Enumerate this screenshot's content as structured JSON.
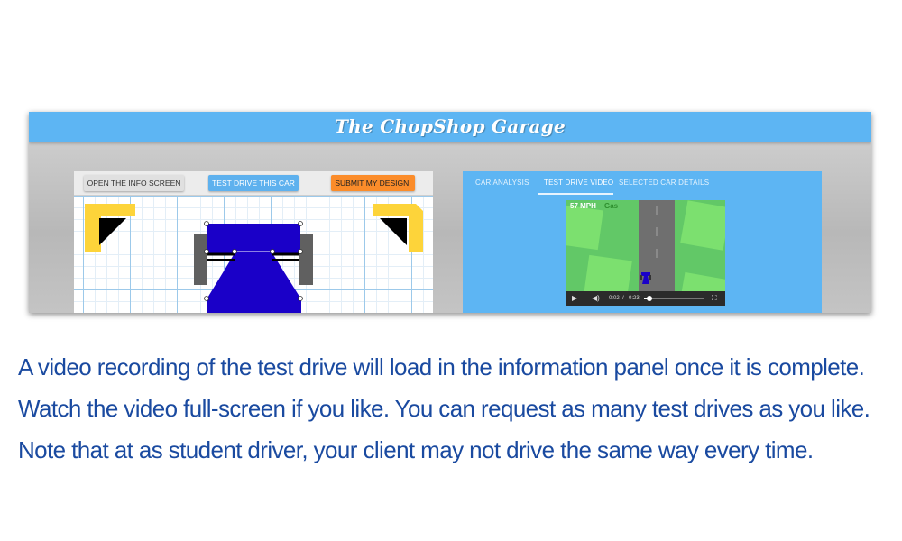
{
  "app": {
    "title": "The ChopShop Garage"
  },
  "design_panel": {
    "buttons": {
      "info": "OPEN THE INFO SCREEN",
      "test_drive": "TEST DRIVE THIS CAR",
      "submit": "SUBMIT MY DESIGN!"
    },
    "colors": {
      "car_body": "#1a00c8",
      "bumper": "#fdd43a",
      "wheel": "#606060"
    }
  },
  "info_panel": {
    "tabs": [
      {
        "label": "CAR ANALYSIS",
        "active": false
      },
      {
        "label": "TEST DRIVE VIDEO",
        "active": true
      },
      {
        "label": "SELECTED CAR DETAILS",
        "active": false
      }
    ],
    "video": {
      "speed": "57 MPH",
      "gas": "Gas",
      "current_time": "0:02",
      "separator": "/",
      "duration": "0:23",
      "progress": 0.09
    }
  },
  "caption": {
    "lines": [
      "A video recording of the test drive will load in the information panel once it is complete.",
      "Watch the video full-screen if you like. You can request as many test drives as you like.",
      "Note that at as student driver, your client may not drive the same way every time."
    ]
  }
}
